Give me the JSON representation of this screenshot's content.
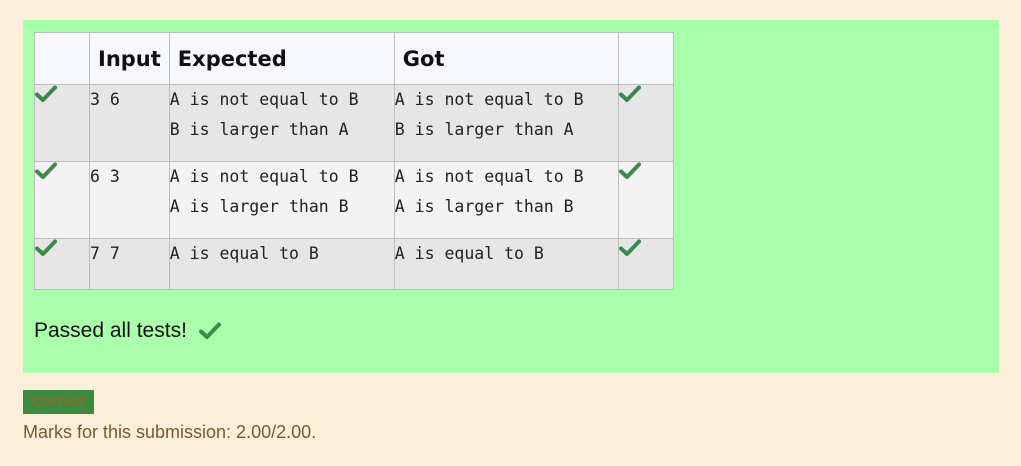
{
  "table": {
    "headers": [
      "",
      "Input",
      "Expected",
      "Got",
      ""
    ],
    "rows": [
      {
        "input": "3 6",
        "expected": "A is not equal to B\nB is larger than A",
        "got": "A is not equal to B\nB is larger than A"
      },
      {
        "input": "6 3",
        "expected": "A is not equal to B\nA is larger than B",
        "got": "A is not equal to B\nA is larger than B"
      },
      {
        "input": "7 7",
        "expected": "A is equal to B",
        "got": "A is equal to B"
      }
    ]
  },
  "summary": {
    "passed_text": "Passed all tests!"
  },
  "grading": {
    "badge": "Correct",
    "marks": "Marks for this submission: 2.00/2.00."
  },
  "colors": {
    "background": "#fcefdc",
    "result_box": "#aaffaa",
    "check": "#3c8a4b"
  },
  "icons": {
    "check": "checkmark-icon"
  }
}
